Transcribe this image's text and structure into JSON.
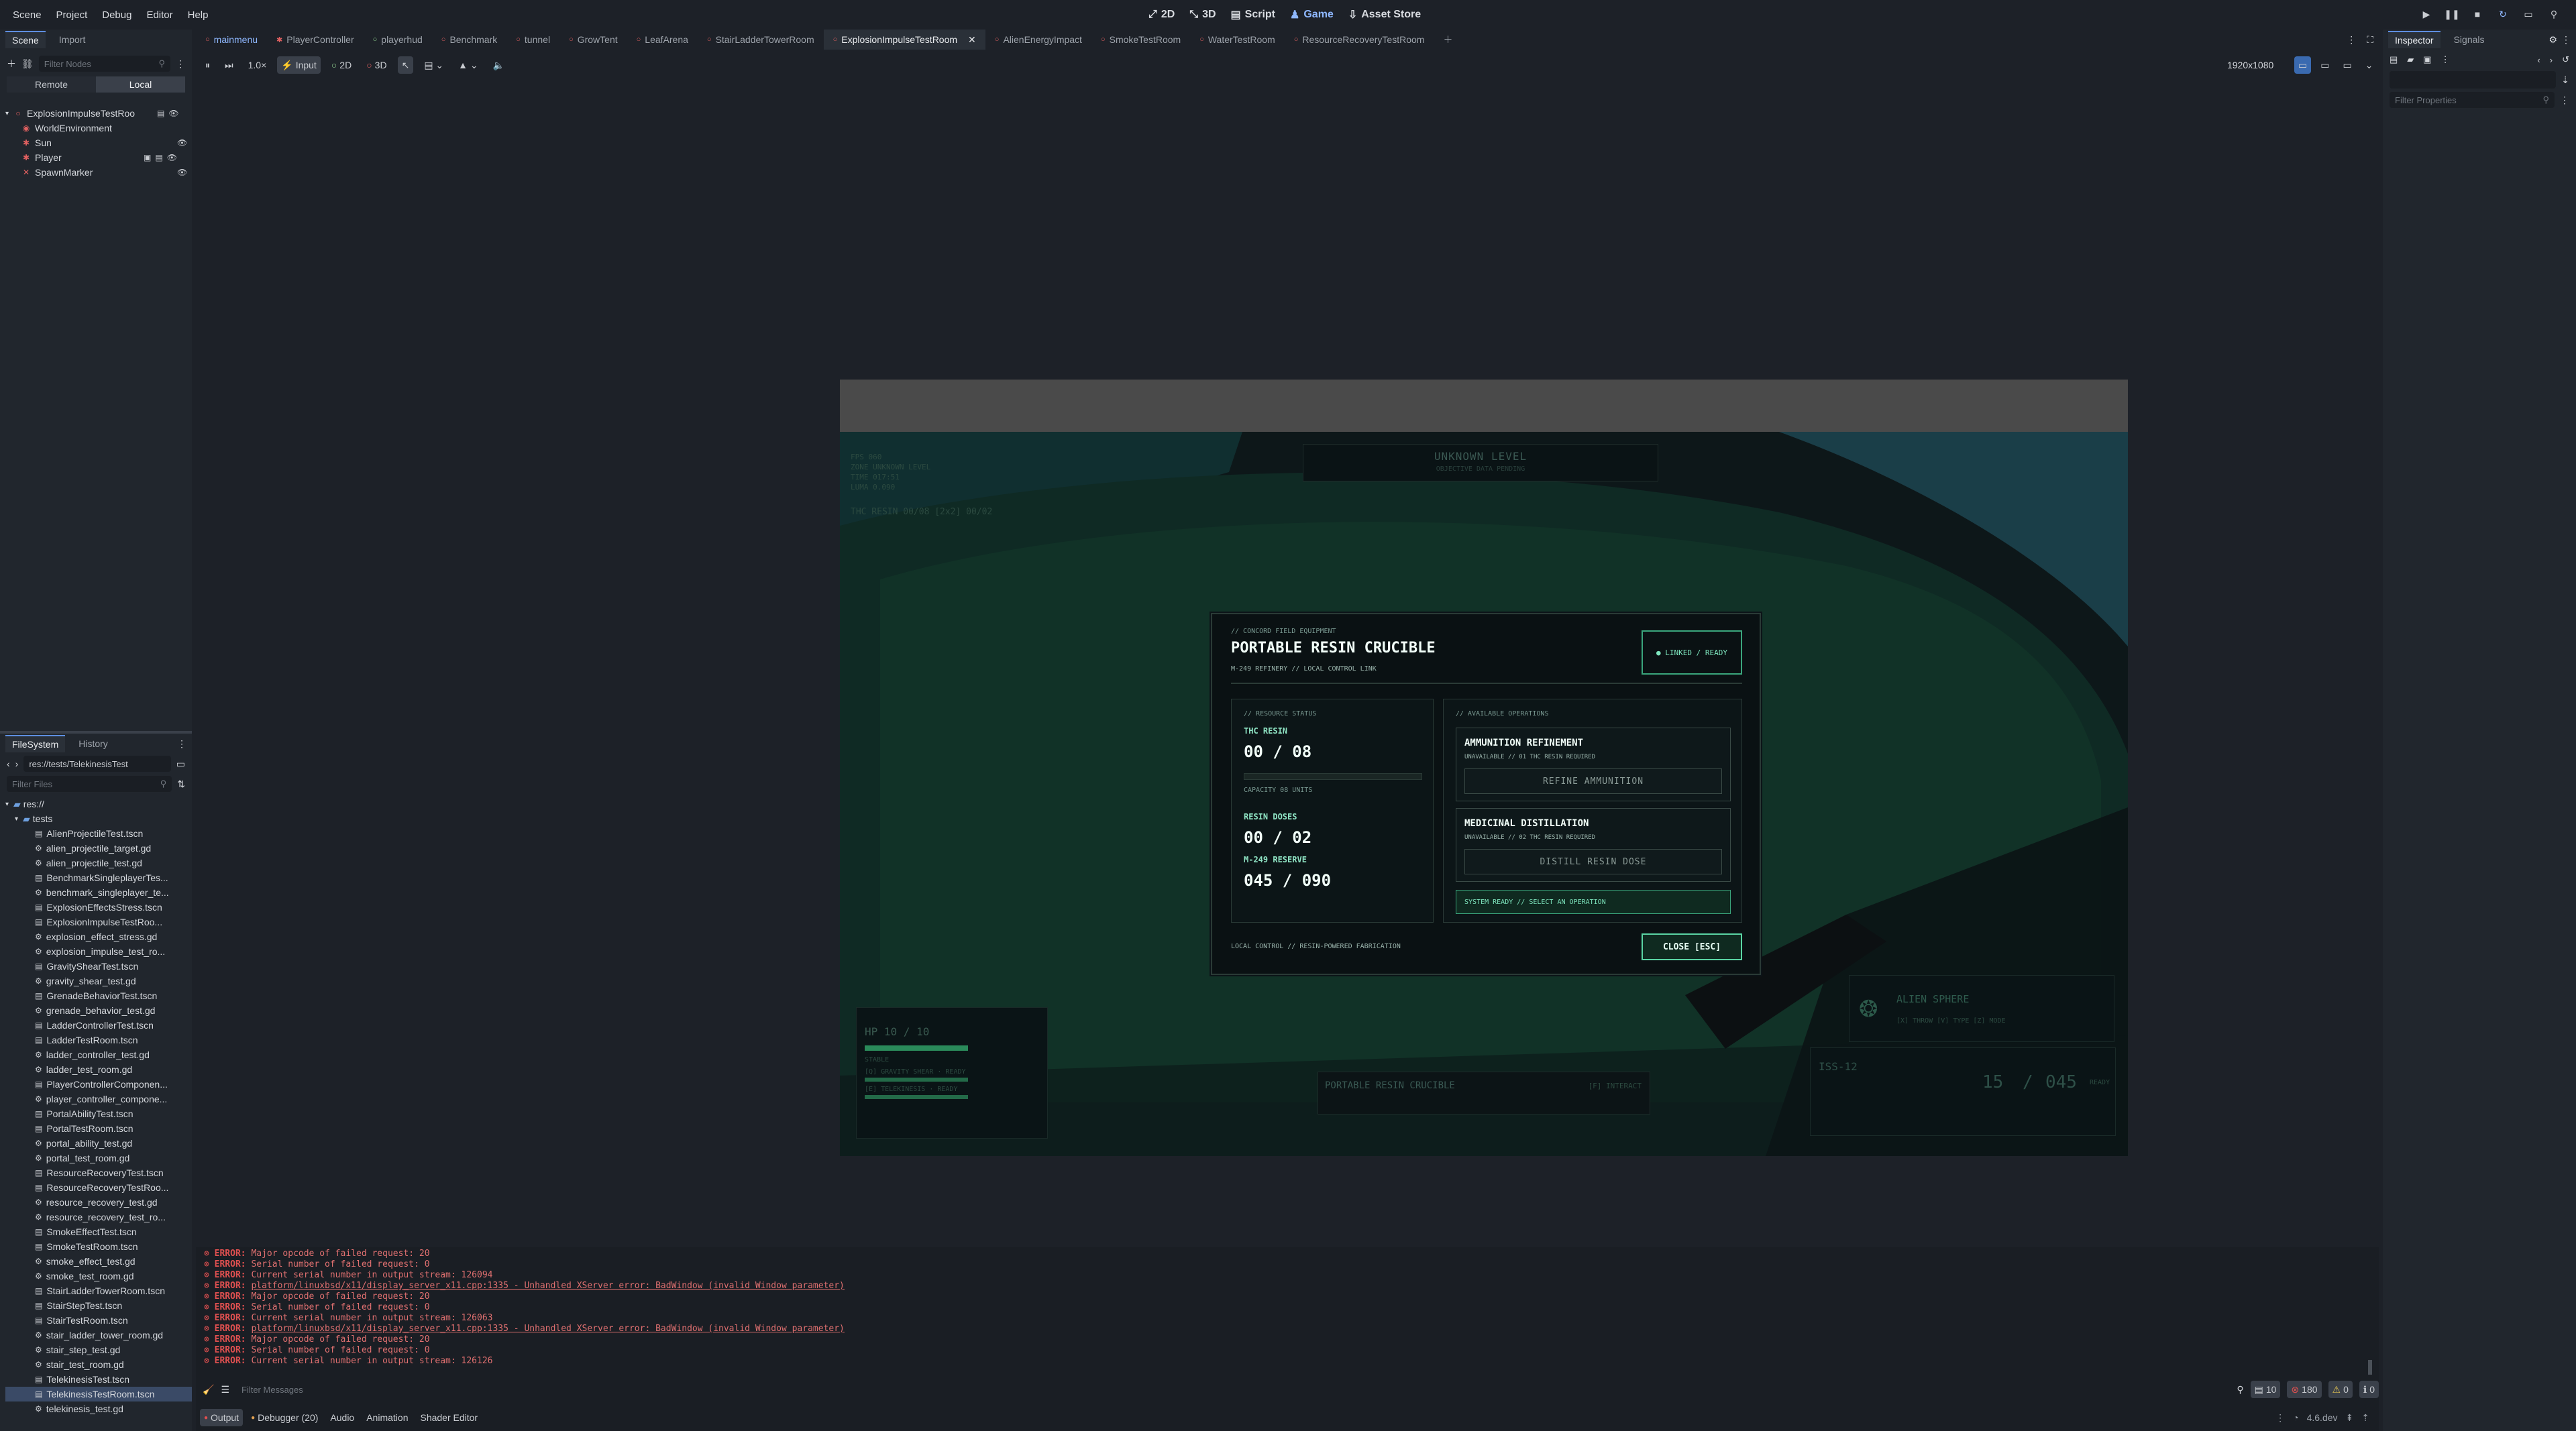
{
  "menu": [
    "Scene",
    "Project",
    "Debug",
    "Editor",
    "Help"
  ],
  "modes": [
    {
      "label": "2D",
      "icon": "2d-icon"
    },
    {
      "label": "3D",
      "icon": "3d-icon"
    },
    {
      "label": "Script",
      "icon": "script-icon"
    },
    {
      "label": "Game",
      "icon": "game-icon"
    },
    {
      "label": "Asset Store",
      "icon": "asset-store-icon"
    }
  ],
  "left": {
    "tabs": [
      "Scene",
      "Import"
    ],
    "filter_placeholder": "Filter Nodes",
    "remote": "Remote",
    "local": "Local",
    "nodes": [
      {
        "name": "ExplosionImpulseTestRoo",
        "indent": 0,
        "icon": "●"
      },
      {
        "name": "WorldEnvironment",
        "indent": 1,
        "icon": "●"
      },
      {
        "name": "Sun",
        "indent": 1,
        "icon": "✱"
      },
      {
        "name": "Player",
        "indent": 1,
        "icon": "✱"
      },
      {
        "name": "SpawnMarker",
        "indent": 1,
        "icon": "✕"
      }
    ]
  },
  "filesystem": {
    "tabs": [
      "FileSystem",
      "History"
    ],
    "path": "res://tests/TelekinesisTest",
    "filter_placeholder": "Filter Files",
    "root": "res://",
    "folder": "tests",
    "files": [
      "AlienProjectileTest.tscn",
      "alien_projectile_target.gd",
      "alien_projectile_test.gd",
      "BenchmarkSingleplayerTes...",
      "benchmark_singleplayer_te...",
      "ExplosionEffectsStress.tscn",
      "ExplosionImpulseTestRoo...",
      "explosion_effect_stress.gd",
      "explosion_impulse_test_ro...",
      "GravityShearTest.tscn",
      "gravity_shear_test.gd",
      "GrenadeBehaviorTest.tscn",
      "grenade_behavior_test.gd",
      "LadderControllerTest.tscn",
      "LadderTestRoom.tscn",
      "ladder_controller_test.gd",
      "ladder_test_room.gd",
      "PlayerControllerComponen...",
      "player_controller_compone...",
      "PortalAbilityTest.tscn",
      "PortalTestRoom.tscn",
      "portal_ability_test.gd",
      "portal_test_room.gd",
      "ResourceRecoveryTest.tscn",
      "ResourceRecoveryTestRoo...",
      "resource_recovery_test.gd",
      "resource_recovery_test_ro...",
      "SmokeEffectTest.tscn",
      "SmokeTestRoom.tscn",
      "smoke_effect_test.gd",
      "smoke_test_room.gd",
      "StairLadderTowerRoom.tscn",
      "StairStepTest.tscn",
      "StairTestRoom.tscn",
      "stair_ladder_tower_room.gd",
      "stair_step_test.gd",
      "stair_test_room.gd",
      "TelekinesisTest.tscn",
      "TelekinesisTestRoom.tscn",
      "telekinesis_test.gd"
    ],
    "selected": "TelekinesisTestRoom.tscn"
  },
  "tabs": [
    "mainmenu",
    "PlayerController",
    "playerhud",
    "Benchmark",
    "tunnel",
    "GrowTent",
    "LeafArena",
    "StairLadderTowerRoom",
    "ExplosionImpulseTestRoom",
    "AlienEnergyImpact",
    "SmokeTestRoom",
    "WaterTestRoom",
    "ResourceRecoveryTestRoom"
  ],
  "active_tab": "ExplosionImpulseTestRoom",
  "toolbar": {
    "zoom": "1.0×",
    "input": "Input",
    "two_d": "2D",
    "three_d": "3D",
    "resolution": "1920x1080"
  },
  "right": {
    "tabs": [
      "Inspector",
      "Signals"
    ],
    "filter_placeholder": "Filter Properties"
  },
  "game": {
    "hud_topleft": [
      "FPS 060",
      "ZONE UNKNOWN LEVEL",
      "TIME 017:51",
      "LUMA 0.090"
    ],
    "hud_resin": "THC RESIN 00/08   [2x2] 00/02",
    "level_title": "UNKNOWN LEVEL",
    "level_sub": "OBJECTIVE DATA PENDING",
    "hp": "HP 10 / 10",
    "hp_status": "STABLE",
    "ability1": "[Q] GRAVITY SHEAR  · READY",
    "ability2": "[E] TELEKINESIS  · READY",
    "weapon_name": "ALIEN SPHERE",
    "weapon_keys": "[X] THROW   [V] TYPE   [Z] MODE",
    "ammo_code": "ISS-12",
    "ammo_cur": "15",
    "ammo_res": "045",
    "ammo_state": "READY",
    "interact": "PORTABLE RESIN CRUCIBLE",
    "interact_key": "[F] INTERACT"
  },
  "modal": {
    "kicker": "// CONCORD FIELD EQUIPMENT",
    "title": "PORTABLE RESIN CRUCIBLE",
    "subtitle": "M-249 REFINERY // LOCAL CONTROL LINK",
    "status": "● LINKED / READY",
    "res_header": "// RESOURCE STATUS",
    "thc_label": "THC RESIN",
    "thc_value": "00 / 08",
    "thc_fill": 0,
    "capacity": "CAPACITY 08 UNITS",
    "doses_label": "RESIN DOSES",
    "doses_value": "00 / 02",
    "reserve_label": "M-249 RESERVE",
    "reserve_value": "045 / 090",
    "ops_header": "// AVAILABLE OPERATIONS",
    "op1_title": "AMMUNITION REFINEMENT",
    "op1_sub": "UNAVAILABLE  // 01 THC RESIN REQUIRED",
    "op1_btn": "REFINE AMMUNITION",
    "op2_title": "MEDICINAL DISTILLATION",
    "op2_sub": "UNAVAILABLE  // 02 THC RESIN REQUIRED",
    "op2_btn": "DISTILL RESIN DOSE",
    "ready": "SYSTEM READY // SELECT AN OPERATION",
    "footer": "LOCAL CONTROL // RESIN-POWERED FABRICATION",
    "close": "CLOSE  [ESC]"
  },
  "output": [
    {
      "lbl": "ERROR:",
      "txt": "    Major opcode of failed request: 20",
      "link": false
    },
    {
      "lbl": "ERROR:",
      "txt": "    Serial number of failed request: 0",
      "link": false
    },
    {
      "lbl": "ERROR:",
      "txt": "    Current serial number in output stream: 126094",
      "link": false
    },
    {
      "lbl": "ERROR:",
      "txt": "platform/linuxbsd/x11/display_server_x11.cpp:1335 - Unhandled XServer error: BadWindow (invalid Window parameter)",
      "link": true
    },
    {
      "lbl": "ERROR:",
      "txt": "    Major opcode of failed request: 20",
      "link": false
    },
    {
      "lbl": "ERROR:",
      "txt": "    Serial number of failed request: 0",
      "link": false
    },
    {
      "lbl": "ERROR:",
      "txt": "    Current serial number in output stream: 126063",
      "link": false
    },
    {
      "lbl": "ERROR:",
      "txt": "platform/linuxbsd/x11/display_server_x11.cpp:1335 - Unhandled XServer error: BadWindow (invalid Window parameter)",
      "link": true
    },
    {
      "lbl": "ERROR:",
      "txt": "    Major opcode of failed request: 20",
      "link": false
    },
    {
      "lbl": "ERROR:",
      "txt": "    Serial number of failed request: 0",
      "link": false
    },
    {
      "lbl": "ERROR:",
      "txt": "    Current serial number in output stream: 126126",
      "link": false
    }
  ],
  "bottom": {
    "filter_placeholder": "Filter Messages",
    "counts": {
      "log": "10",
      "errors": "180",
      "warnings": "0",
      "info": "0"
    },
    "tabs": [
      "Output",
      "Debugger (20)",
      "Audio",
      "Animation",
      "Shader Editor"
    ],
    "version": "4.6.dev"
  },
  "colors": {
    "accent": "#5e8ee0",
    "terminal": "#5ad5a4",
    "error": "#e05050"
  }
}
